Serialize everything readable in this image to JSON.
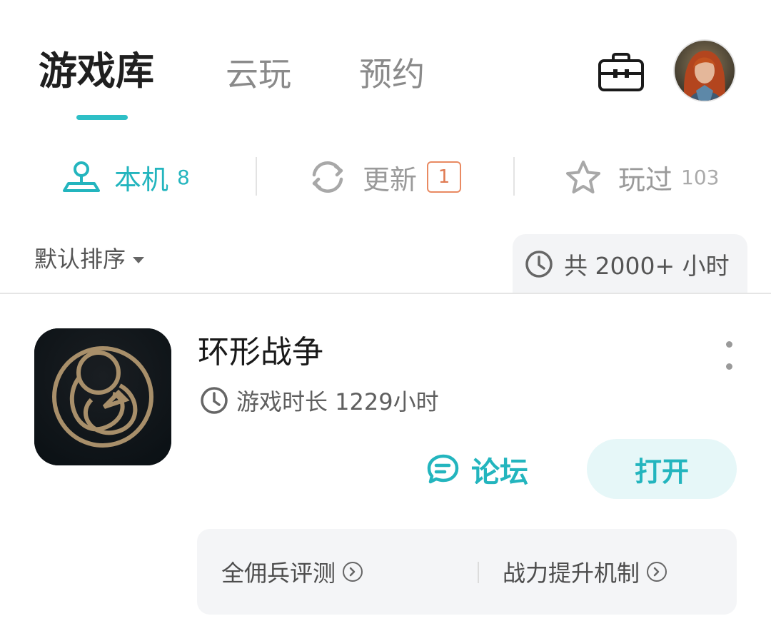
{
  "colors": {
    "accent": "#2ebfc6",
    "badge": "#e07a52",
    "muted_text": "#8a8a8a",
    "chip_bg": "#f3f4f6"
  },
  "header": {
    "tabs": [
      {
        "label": "游戏库",
        "active": true
      },
      {
        "label": "云玩",
        "active": false
      },
      {
        "label": "预约",
        "active": false
      }
    ],
    "icons": [
      "toolbox-icon",
      "user-avatar"
    ]
  },
  "filters": [
    {
      "label": "本机",
      "count": "8",
      "icon": "map-pin-icon",
      "active": true
    },
    {
      "label": "更新",
      "count": "1",
      "icon": "refresh-icon",
      "active": false
    },
    {
      "label": "玩过",
      "count": "103",
      "icon": "star-outline-icon",
      "active": false
    }
  ],
  "sort": {
    "label": "默认排序",
    "total_hours": "共 2000+ 小时"
  },
  "games": [
    {
      "title": "环形战争",
      "playtime": "游戏时长 1229小时",
      "forum_label": "论坛",
      "open_label": "打开",
      "tips": [
        "全佣兵评测",
        "战力提升机制"
      ]
    }
  ]
}
